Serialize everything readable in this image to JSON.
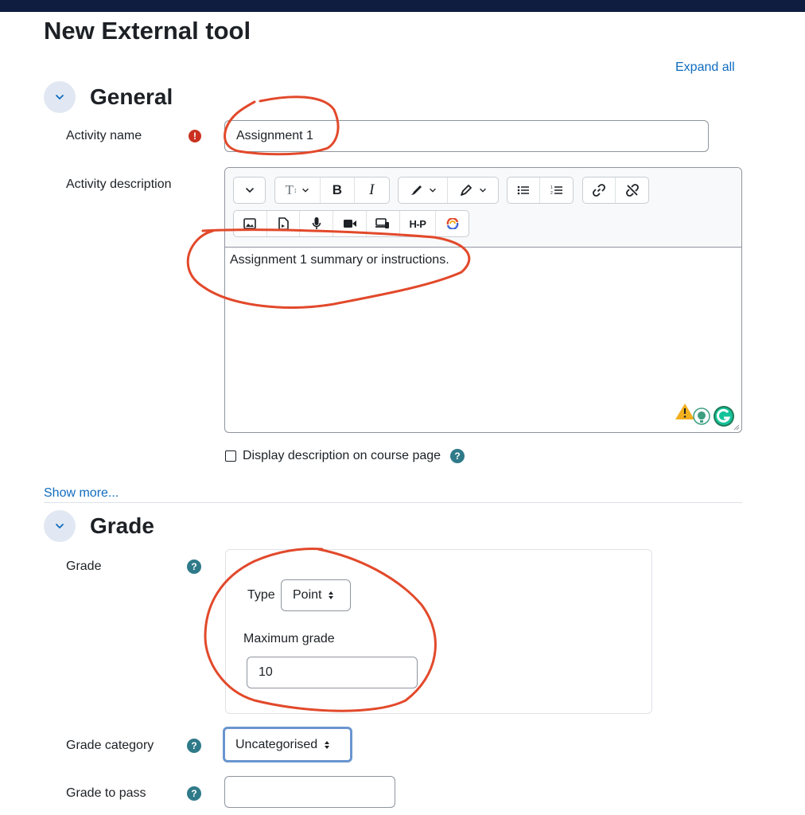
{
  "page": {
    "title": "New External tool",
    "expand_all": "Expand all"
  },
  "general": {
    "title": "General",
    "activity_name": {
      "label": "Activity name",
      "value": "Assignment 1"
    },
    "activity_description": {
      "label": "Activity description",
      "content": "Assignment 1 summary or instructions.",
      "toolbar": {
        "row1": [
          "collapse-icon",
          "text-style-icon",
          "bold-icon",
          "italic-icon",
          "text-color-icon",
          "highlight-icon",
          "bullet-list-icon",
          "numbered-list-icon",
          "link-icon",
          "unlink-icon"
        ],
        "row2": [
          "image-icon",
          "media-icon",
          "audio-icon",
          "video-icon",
          "screen-record-icon",
          "h5p-icon",
          "integration-icon"
        ],
        "bold_glyph": "B",
        "italic_glyph": "I",
        "h5p_label": "H-P"
      }
    },
    "display_description": {
      "label": "Display description on course page",
      "checked": false
    },
    "show_more": "Show more..."
  },
  "grade": {
    "title": "Grade",
    "grade_label": "Grade",
    "type_label": "Type",
    "type_value": "Point",
    "max_grade_label": "Maximum grade",
    "max_grade_value": "10",
    "category_label": "Grade category",
    "category_value": "Uncategorised",
    "to_pass_label": "Grade to pass",
    "to_pass_value": ""
  },
  "colors": {
    "accent": "#0f6cbf",
    "required": "#ca3120",
    "help": "#2f7a89",
    "annotation": "#e2492b",
    "topbar": "#0f1d40"
  }
}
